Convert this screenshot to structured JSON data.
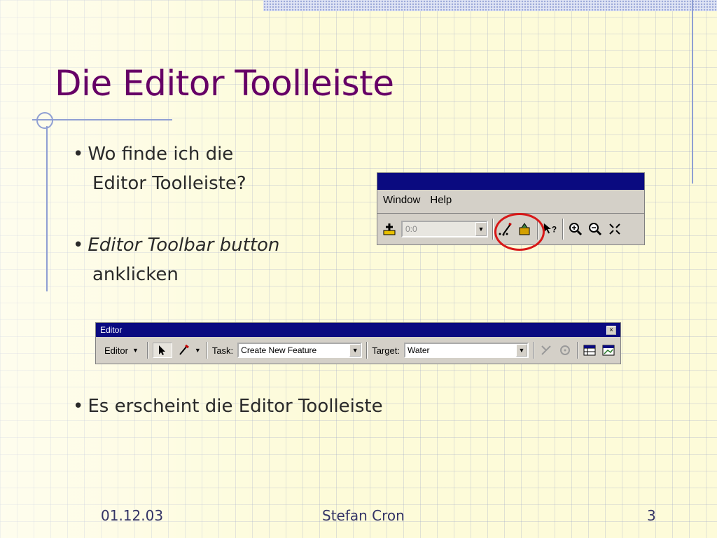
{
  "slide": {
    "title": "Die Editor Toolleiste",
    "bullets": [
      {
        "line1": "Wo finde ich die",
        "line2": "Editor Toolleiste?"
      },
      {
        "line1": "Editor Toolbar button",
        "line2": "anklicken"
      },
      {
        "line1": "Es erscheint die Editor Toolleiste"
      }
    ],
    "bullet_glyph": "•"
  },
  "standard_toolbar": {
    "menu": [
      "Window",
      "Help"
    ],
    "scale_value": "0:0",
    "icons": [
      "add-data-icon",
      "editor-toolbar-icon",
      "arctoolbox-icon",
      "whats-this-icon",
      "zoom-in-icon",
      "zoom-out-icon",
      "full-extent-icon"
    ],
    "highlight_color": "#d81818"
  },
  "editor_toolbar": {
    "title": "Editor",
    "close_glyph": "×",
    "editor_menu": "Editor",
    "task_label": "Task:",
    "task_value": "Create New Feature",
    "target_label": "Target:",
    "target_value": "Water"
  },
  "footer": {
    "date": "01.12.03",
    "author": "Stefan Cron",
    "page": "3"
  },
  "colors": {
    "title": "#660066",
    "accent_lines": "#8f9fd3",
    "titlebar": "#0a0a80"
  }
}
